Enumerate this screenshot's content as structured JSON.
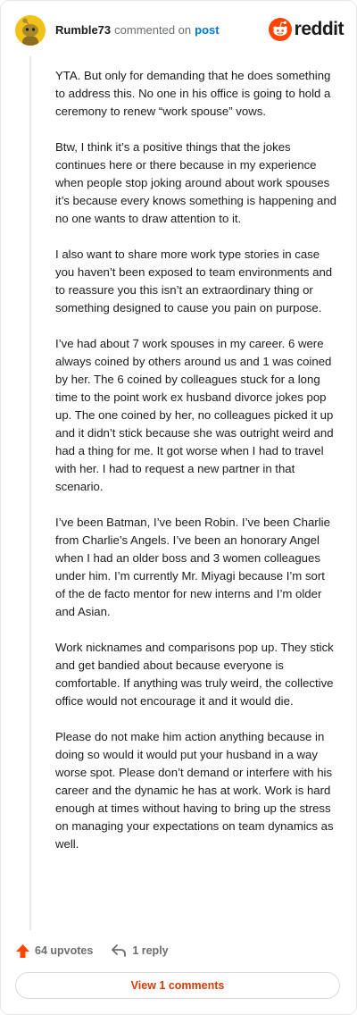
{
  "comment": {
    "username": "Rumble73",
    "action_text": "commented on",
    "post_link": "post",
    "brand_name": "reddit",
    "paragraphs": [
      "YTA. But only for demanding that he does something to address this. No one in his office is going to hold a ceremony to renew “work spouse” vows.",
      "Btw, I think it’s a positive things that the jokes continues here or there because in my experience when people stop joking around about work spouses it’s because every knows something is happening and no one wants to draw attention to it.",
      "I also want to share more work type stories in case you haven’t been exposed to team environments and to reassure you this isn’t an extraordinary thing or something designed to cause you pain on purpose.",
      "I’ve had about 7 work spouses in my career. 6 were always coined by others around us and 1 was coined by her. The 6 coined by colleagues stuck for a long time to the point work ex husband divorce jokes pop up. The one coined by her, no colleagues picked it up and it didn’t stick because she was outright weird and had a thing for me. It got worse when I had to travel with her. I had to request a new partner in that scenario.",
      "I’ve been Batman, I’ve been Robin. I’ve been Charlie from Charlie’s Angels. I’ve been an honorary Angel when I had an older boss and 3 women colleagues under him. I’m currently Mr. Miyagi because I’m sort of the de facto mentor for new interns and I’m older and Asian.",
      "Work nicknames and comparisons pop up. They stick and get bandied about because everyone is comfortable. If anything was truly weird, the collective office would not encourage it and it would die.",
      "Please do not make him action anything because in doing so would it would put your husband in a way worse spot. Please don’t demand or interfere with his career and the dynamic he has at work. Work is hard enough at times without having to bring up the stress on managing your expectations on team dynamics as well."
    ]
  },
  "actions": {
    "upvotes_label": "64 upvotes",
    "reply_label": "1 reply",
    "view_comments_label": "View 1 comments"
  },
  "icons": {
    "avatar": "snoo-avatar-icon",
    "brand": "reddit-logo-icon",
    "upvote": "upvote-arrow-icon",
    "reply": "reply-arrow-icon"
  },
  "colors": {
    "accent_orange": "#ff4500",
    "link_blue": "#0079d3",
    "muted_text": "#6b6f72",
    "avatar_yellow": "#f2c21b",
    "view_comments_text": "#d93a00"
  }
}
